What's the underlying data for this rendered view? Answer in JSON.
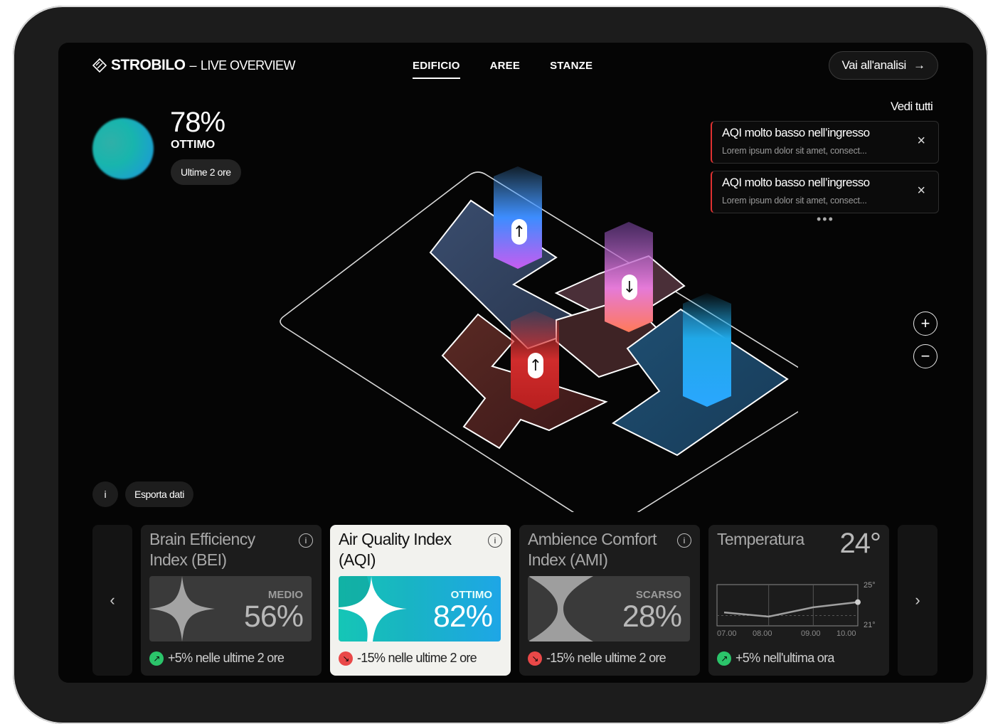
{
  "app": {
    "brand": "STROBILO",
    "separator": "–",
    "subtitle": "LIVE OVERVIEW"
  },
  "nav": {
    "tabs": [
      {
        "label": "EDIFICIO",
        "active": true
      },
      {
        "label": "AREE",
        "active": false
      },
      {
        "label": "STANZE",
        "active": false
      }
    ]
  },
  "header": {
    "cta_label": "Vai all'analisi",
    "cta_arrow": "→"
  },
  "score": {
    "value": "78%",
    "grade": "OTTIMO",
    "period": "Ultime 2 ore",
    "color_from": "#2fb0a8",
    "color_to": "#1b9fd0"
  },
  "alerts": {
    "see_all": "Vedi tutti",
    "more": "•••",
    "items": [
      {
        "title": "AQI molto basso nell’ingresso",
        "desc": "Lorem ipsum dolor sit amet, consect...",
        "close": "×"
      },
      {
        "title": "AQI molto basso nell’ingresso",
        "desc": "Lorem ipsum dolor sit amet, consect...",
        "close": "×"
      }
    ]
  },
  "map": {
    "zoom_in": "+",
    "zoom_out": "−",
    "markers": [
      {
        "icon": "↑",
        "color": "#5aa8ff"
      },
      {
        "icon": "↓",
        "color": "#e07ad9"
      },
      {
        "icon": "↑",
        "color": "#d83030"
      }
    ]
  },
  "actions": {
    "info": "i",
    "export": "Esporta dati"
  },
  "carousel": {
    "prev": "‹",
    "next": "›"
  },
  "cards": [
    {
      "title": "Brain Efficiency Index (BEI)",
      "info": "i",
      "label": "MEDIO",
      "value": "56%",
      "trend_icon": "↗",
      "trend": "+5% nelle ultime 2 ore",
      "trend_color": "#2bc46a"
    },
    {
      "title": "Air Quality Index (AQI)",
      "info": "i",
      "label": "OTTIMO",
      "value": "82%",
      "trend_icon": "↘",
      "trend": "-15% nelle ultime 2 ore",
      "trend_color": "#e94848"
    },
    {
      "title": "Ambience Comfort Index (AMI)",
      "info": "i",
      "label": "SCARSO",
      "value": "28%",
      "trend_icon": "↘",
      "trend": "-15% nelle ultime 2 ore",
      "trend_color": "#e94848"
    },
    {
      "title": "Temperatura",
      "value": "24°",
      "trend_icon": "↗",
      "trend": "+5% nell'ultima ora",
      "trend_color": "#2bc46a"
    }
  ],
  "chart_data": {
    "type": "line",
    "title": "",
    "x": [
      "07.00",
      "08.00",
      "09.00",
      "10.00"
    ],
    "series": [
      {
        "values": [
          22.3,
          21.9,
          22.8,
          23.3
        ]
      }
    ],
    "ylim": [
      21,
      25
    ],
    "y_ticks": [
      "25°",
      "21°"
    ],
    "grid": true
  }
}
